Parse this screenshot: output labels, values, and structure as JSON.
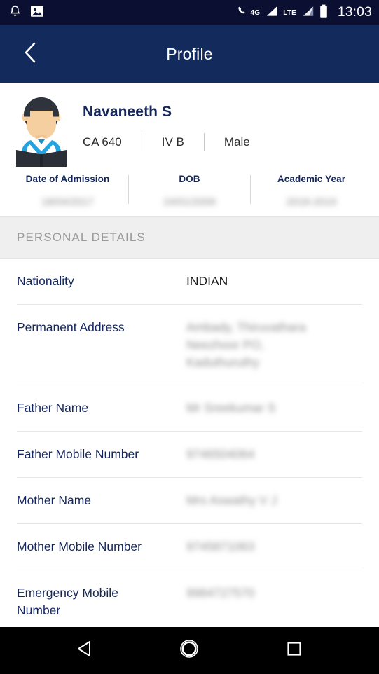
{
  "statusbar": {
    "icons": [
      "bell-icon",
      "image-icon"
    ],
    "network_label_1": "4G",
    "network_label_2": "LTE",
    "clock": "13:03"
  },
  "appbar": {
    "back_icon": "chevron-left-icon",
    "title": "Profile"
  },
  "profile": {
    "avatar_alt": "student-reading-avatar",
    "name": "Navaneeth S",
    "sub": [
      {
        "label": "CA 640"
      },
      {
        "label": "IV B"
      },
      {
        "label": "Male"
      }
    ],
    "stats": [
      {
        "label": "Date of Admission",
        "value": "18/04/2017",
        "redacted": true
      },
      {
        "label": "DOB",
        "value": "24/01/2009",
        "redacted": true
      },
      {
        "label": "Academic Year",
        "value": "2018-2019",
        "redacted": true
      }
    ]
  },
  "section": {
    "title": "PERSONAL DETAILS"
  },
  "details": [
    {
      "label": "Nationality",
      "value": "INDIAN",
      "redacted": false
    },
    {
      "label": "Permanent Address",
      "lines": [
        "Ambady, Thiruvathara",
        "Neezhoor PO,",
        "Kaduthuruthy"
      ],
      "redacted": true
    },
    {
      "label": "Father Name",
      "value": "Mr Sreekumar S",
      "redacted": true
    },
    {
      "label": "Father Mobile Number",
      "value": "9746504064",
      "redacted": true
    },
    {
      "label": "Mother Name",
      "value": "Mrs Aswathy V J",
      "redacted": true
    },
    {
      "label": "Mother Mobile Number",
      "value": "9745871063",
      "redacted": true
    },
    {
      "label": "Emergency Mobile Number",
      "value": "9984727570",
      "redacted": true
    }
  ],
  "navbar": {
    "back": "back-triangle-icon",
    "home": "home-circle-icon",
    "recents": "recents-square-icon"
  },
  "colors": {
    "statusbar_bg": "#0b1033",
    "appbar_bg": "#132a5c",
    "accent_navy": "#15275c",
    "section_band": "#efefef",
    "navbar_bg": "#000000"
  }
}
